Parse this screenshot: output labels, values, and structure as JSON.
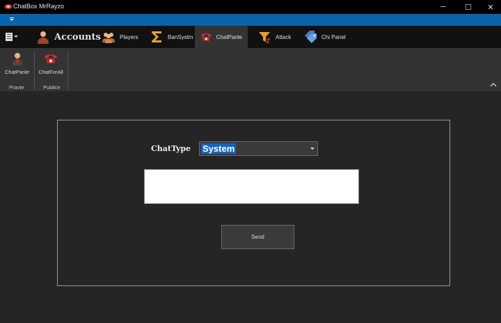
{
  "window": {
    "title": "ChatBox MrRayzo",
    "controls": {
      "minimize": "─",
      "maximize": "☐",
      "close": "✕"
    }
  },
  "tabs": [
    {
      "label": "Accounts",
      "icon": "user-agent-icon",
      "active": false
    },
    {
      "label": "Players",
      "icon": "group-icon",
      "active": false
    },
    {
      "label": "BanSystm",
      "icon": "sigma-icon",
      "active": false
    },
    {
      "label": "ChatPanle",
      "icon": "telephone-icon",
      "active": true
    },
    {
      "label": "Attack",
      "icon": "funnel-icon",
      "active": false
    },
    {
      "label": "Chi Panel",
      "icon": "tags-icon",
      "active": false
    }
  ],
  "ribbon": {
    "buttons": [
      {
        "label": "ChatPanle",
        "icon": "person-icon"
      },
      {
        "label": "ChatForAll",
        "icon": "telephone-icon"
      }
    ],
    "groups": [
      "Pravte",
      "Publice"
    ]
  },
  "form": {
    "chattype_label": "ChatType",
    "chattype_value": "System",
    "message_value": "",
    "send_label": "Send"
  },
  "colors": {
    "titlebar": "#000000",
    "qat_bar": "#0a64aa",
    "tabbar": "#111111",
    "ribbon": "#333333",
    "background": "#252526",
    "selection": "#1565c0"
  }
}
